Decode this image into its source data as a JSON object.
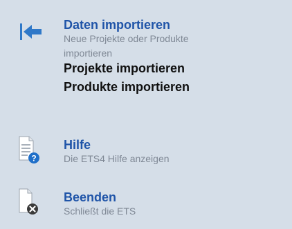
{
  "menu": {
    "import": {
      "title": "Daten importieren",
      "description": "Neue Projekte oder Produkte importieren",
      "icon": "import-arrow-icon",
      "sub_items": [
        {
          "label": "Projekte importieren"
        },
        {
          "label": "Produkte importieren"
        }
      ]
    },
    "help": {
      "title": "Hilfe",
      "description": "Die ETS4 Hilfe anzeigen",
      "icon": "help-document-icon"
    },
    "exit": {
      "title": "Beenden",
      "description": "Schließt die ETS",
      "icon": "close-document-icon"
    }
  },
  "colors": {
    "background": "#d5dee8",
    "title_blue": "#1f54a8",
    "description_gray": "#7f8895",
    "accent_blue": "#2f78c8"
  }
}
